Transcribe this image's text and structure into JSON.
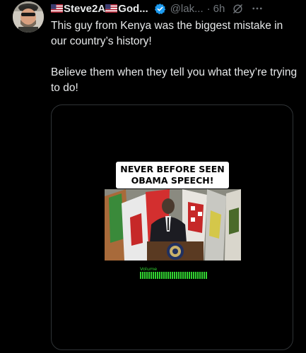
{
  "tweet": {
    "display_name": "Steve2A",
    "display_name_suffix": "God...",
    "handle": "@lak...",
    "separator": "·",
    "time": "6h",
    "text_paragraphs": [
      "This guy from Kenya was the biggest mistake in our country’s history!",
      "Believe them when they tell you what they’re trying to do!"
    ]
  },
  "media": {
    "caption_line1": "NEVER BEFORE SEEN",
    "caption_line2": "OBAMA SPEECH!",
    "volume_label": "Volume",
    "volume_level": 1.0
  },
  "icons": {
    "verified": "verified-badge-icon",
    "grok": "grok-icon",
    "more": "more-options-icon",
    "flag": "us-flag-icon"
  },
  "colors": {
    "background": "#000000",
    "text_primary": "#e7e9ea",
    "text_secondary": "#71767b",
    "verified_blue": "#1d9bf0",
    "volume_green": "#31d431",
    "border": "#2f3336"
  }
}
